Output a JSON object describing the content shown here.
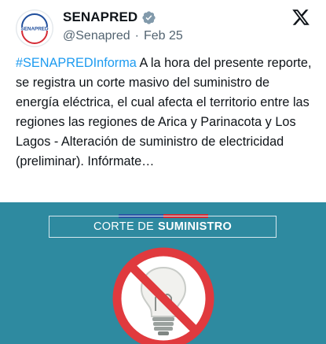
{
  "tweet": {
    "author": {
      "display_name": "SENAPRED",
      "handle": "@Senapred",
      "avatar_text": "SENAPRED",
      "verified_icon": "verified-badge-icon"
    },
    "separator": "·",
    "date": "Feb 25",
    "platform_icon": "x-logo-icon",
    "hashtag": "#SENAPREDInforma",
    "body": " A la hora del presente reporte, se registra un corte masivo del suministro de energía eléctrica, el cual afecta el territorio entre las regiones las regiones de Arica y Parinacota y Los Lagos - Alteración de suministro de electricidad (preliminar). Infórmate…",
    "media": {
      "banner_light": "CORTE DE",
      "banner_bold": "SUMINISTRO",
      "icon": "no-electricity-bulb-icon",
      "colors": {
        "background": "#2e8aa0",
        "prohibition": "#e03a3e",
        "flag_blue": "#2b56a5",
        "flag_red": "#d52b35"
      }
    }
  }
}
